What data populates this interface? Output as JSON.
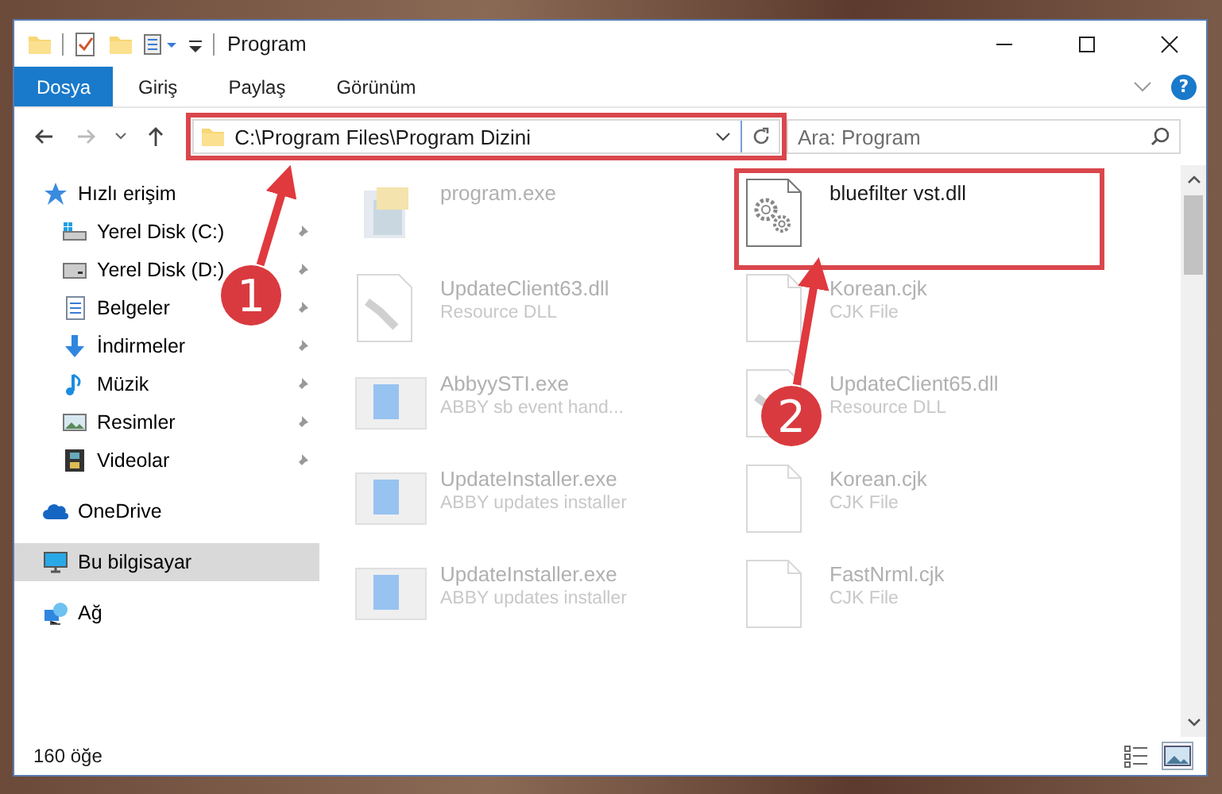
{
  "window": {
    "title": "Program"
  },
  "ribbon": {
    "help": "?",
    "tabs": [
      {
        "label": "Dosya",
        "selected": true
      },
      {
        "label": "Giriş",
        "selected": false
      },
      {
        "label": "Paylaş",
        "selected": false
      },
      {
        "label": "Görünüm",
        "selected": false
      }
    ]
  },
  "address_bar": {
    "path": "C:\\Program Files\\Program Dizini",
    "highlighted": true
  },
  "search": {
    "placeholder": "Ara: Program"
  },
  "sidebar": {
    "items": [
      {
        "label": "Hızlı erişim",
        "kind": "star",
        "selected": false,
        "children": [
          {
            "label": "Yerel Disk (C:)",
            "kind": "drive-c",
            "pinned": true,
            "selected": false
          },
          {
            "label": "Yerel Disk (D:)",
            "kind": "drive",
            "pinned": true,
            "selected": false
          },
          {
            "label": "Belgeler",
            "kind": "documents",
            "pinned": true,
            "selected": false
          },
          {
            "label": "İndirmeler",
            "kind": "downloads",
            "pinned": true,
            "selected": false
          },
          {
            "label": "Müzik",
            "kind": "music",
            "pinned": true,
            "selected": false
          },
          {
            "label": "Resimler",
            "kind": "pictures",
            "pinned": true,
            "selected": false
          },
          {
            "label": "Videolar",
            "kind": "videos",
            "pinned": true,
            "selected": false
          }
        ]
      },
      {
        "label": "OneDrive",
        "kind": "cloud",
        "selected": false
      },
      {
        "label": "Bu bilgisayar",
        "kind": "computer",
        "selected": true
      },
      {
        "label": "Ağ",
        "kind": "network",
        "selected": false
      }
    ]
  },
  "files": [
    {
      "name": "program.exe",
      "kind": "app",
      "dimmed": true,
      "highlighted": false
    },
    {
      "name": "bluefilter vst.dll",
      "kind": "gear",
      "dimmed": false,
      "highlighted": true
    },
    {
      "name": "UpdateClient63.dll",
      "type": "Resource DLL",
      "kind": "resource",
      "dimmed": true,
      "highlighted": false
    },
    {
      "name": "Korean.cjk",
      "type": "CJK File",
      "kind": "blank",
      "dimmed": true,
      "highlighted": false
    },
    {
      "name": "AbbyySTI.exe",
      "type": "ABBY sb event hand...",
      "kind": "installer",
      "dimmed": true,
      "highlighted": false
    },
    {
      "name": "UpdateClient65.dll",
      "type": "Resource DLL",
      "kind": "resource",
      "dimmed": true,
      "highlighted": false
    },
    {
      "name": "UpdateInstaller.exe",
      "type": "ABBY updates installer",
      "kind": "installer",
      "dimmed": true,
      "highlighted": false
    },
    {
      "name": "Korean.cjk",
      "type": "CJK File",
      "kind": "blank",
      "dimmed": true,
      "highlighted": false
    },
    {
      "name": "UpdateInstaller.exe",
      "type": "ABBY updates installer",
      "kind": "installer",
      "dimmed": true,
      "highlighted": false
    },
    {
      "name": "FastNrml.cjk",
      "type": "CJK File",
      "kind": "blank",
      "dimmed": true,
      "highlighted": false
    }
  ],
  "status_bar": {
    "count": "160 öğe",
    "views": [
      {
        "kind": "details",
        "selected": false
      },
      {
        "kind": "large-icons",
        "selected": true
      }
    ]
  },
  "annotations": [
    {
      "label": "1"
    },
    {
      "label": "2"
    }
  ]
}
